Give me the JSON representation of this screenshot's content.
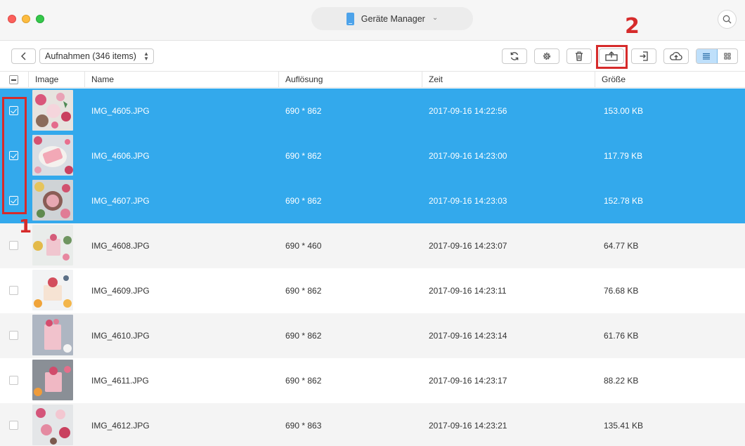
{
  "header": {
    "device_name": "Geräte Manager"
  },
  "toolbar": {
    "album_label": "Aufnahmen (346 items)",
    "buttons": [
      "back-icon",
      "refresh-icon",
      "settings-icon",
      "trash-icon",
      "export-to-computer-icon",
      "import-icon",
      "cloud-upload-icon"
    ],
    "view_modes": [
      "list-view-icon",
      "grid-view-icon"
    ],
    "active_view": "list"
  },
  "callouts": {
    "one": "1",
    "two": "2"
  },
  "table": {
    "columns": [
      "Image",
      "Name",
      "Auflösung",
      "Zeit",
      "Größe"
    ],
    "rows": [
      {
        "name": "IMG_4605.JPG",
        "resolution": "690 * 862",
        "time": "2017-09-16 14:22:56",
        "size": "153.00 KB",
        "selected": true
      },
      {
        "name": "IMG_4606.JPG",
        "resolution": "690 * 862",
        "time": "2017-09-16 14:23:00",
        "size": "117.79 KB",
        "selected": true
      },
      {
        "name": "IMG_4607.JPG",
        "resolution": "690 * 862",
        "time": "2017-09-16 14:23:03",
        "size": "152.78 KB",
        "selected": true
      },
      {
        "name": "IMG_4608.JPG",
        "resolution": "690 * 460",
        "time": "2017-09-16 14:23:07",
        "size": "64.77 KB",
        "selected": false
      },
      {
        "name": "IMG_4609.JPG",
        "resolution": "690 * 862",
        "time": "2017-09-16 14:23:11",
        "size": "76.68 KB",
        "selected": false
      },
      {
        "name": "IMG_4610.JPG",
        "resolution": "690 * 862",
        "time": "2017-09-16 14:23:14",
        "size": "61.76 KB",
        "selected": false
      },
      {
        "name": "IMG_4611.JPG",
        "resolution": "690 * 862",
        "time": "2017-09-16 14:23:17",
        "size": "88.22 KB",
        "selected": false
      },
      {
        "name": "IMG_4612.JPG",
        "resolution": "690 * 863",
        "time": "2017-09-16 14:23:21",
        "size": "135.41 KB",
        "selected": false
      }
    ]
  },
  "colors": {
    "selection": "#33a9ec",
    "callout": "#d62b2b",
    "alt_row": "#f4f4f4"
  }
}
